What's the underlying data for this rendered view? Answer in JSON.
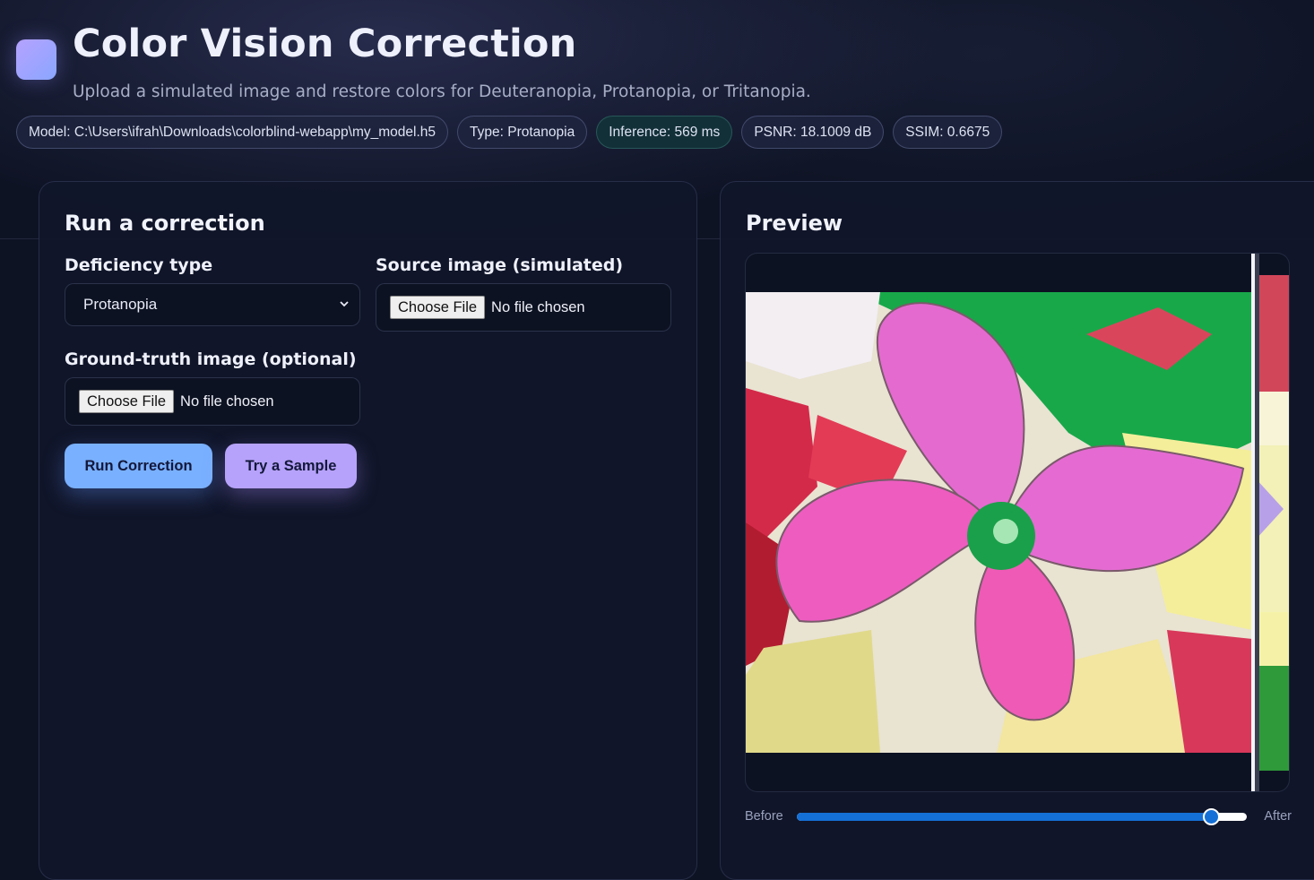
{
  "header": {
    "title": "Color Vision Correction",
    "subtitle": "Upload a simulated image and restore colors for Deuteranopia, Protanopia, or Tritanopia."
  },
  "chips": {
    "model": "Model: C:\\Users\\ifrah\\Downloads\\colorblind-webapp\\my_model.h5",
    "type": "Type: Protanopia",
    "inference": "Inference: 569 ms",
    "psnr": "PSNR: 18.1009 dB",
    "ssim": "SSIM: 0.6675"
  },
  "form": {
    "heading": "Run a correction",
    "deficiency_label": "Deficiency type",
    "deficiency_selected": "Protanopia",
    "source_label": "Source image (simulated)",
    "ground_truth_label": "Ground-truth image (optional)",
    "choose_file_label": "Choose File",
    "no_file_text": "No file chosen",
    "run_button": "Run Correction",
    "sample_button": "Try a Sample"
  },
  "preview": {
    "heading": "Preview",
    "before_label": "Before",
    "after_label": "After",
    "slider_value": 0.92
  },
  "colors": {
    "accent_blue": "#79b0ff",
    "accent_purple": "#b6a2fb",
    "slider_blue": "#1470d6"
  }
}
